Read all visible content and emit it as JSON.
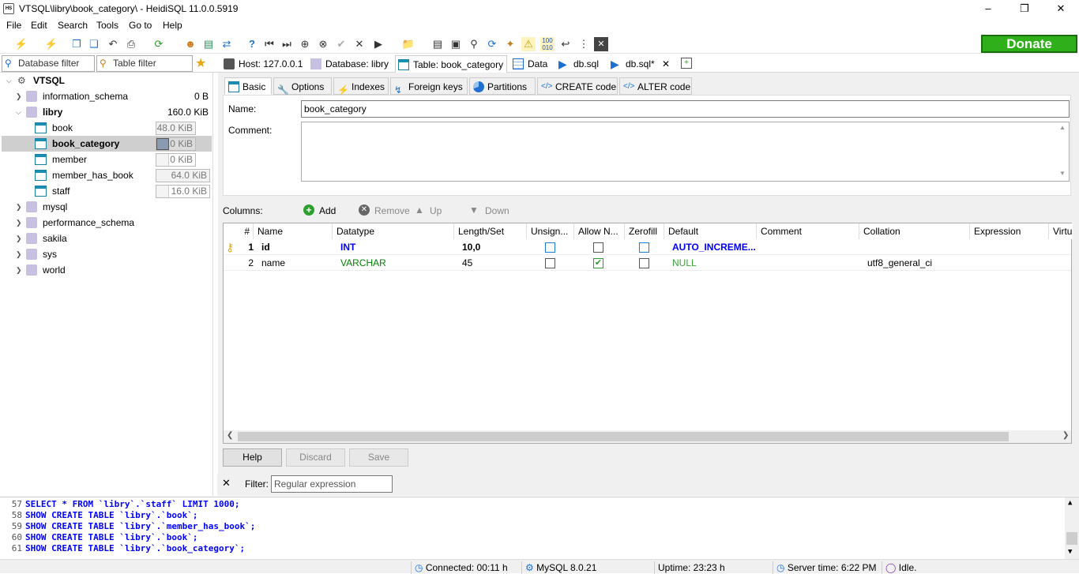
{
  "window": {
    "title": "VTSQL\\libry\\book_category\\ - HeidiSQL 11.0.0.5919",
    "app_icon": "HS"
  },
  "menu": [
    "File",
    "Edit",
    "Search",
    "Tools",
    "Go to",
    "Help"
  ],
  "toolbar": {
    "donate_label": "Donate"
  },
  "filters": {
    "database_filter": "Database filter",
    "table_filter": "Table filter"
  },
  "main_tabs": [
    {
      "label": "Host: 127.0.0.1"
    },
    {
      "label": "Database: libry"
    },
    {
      "label": "Table: book_category"
    },
    {
      "label": "Data"
    },
    {
      "label": "db.sql"
    },
    {
      "label": "db.sql*"
    }
  ],
  "tree": {
    "root": "VTSQL",
    "nodes": [
      {
        "label": "information_schema",
        "size": "0 B"
      },
      {
        "label": "libry",
        "size": "160.0 KiB"
      },
      {
        "label": "book",
        "size": "48.0 KiB"
      },
      {
        "label": "book_category",
        "size": "16.0 KiB"
      },
      {
        "label": "member",
        "size": "16.0 KiB"
      },
      {
        "label": "member_has_book",
        "size": "64.0 KiB"
      },
      {
        "label": "staff",
        "size": "16.0 KiB"
      },
      {
        "label": "mysql"
      },
      {
        "label": "performance_schema"
      },
      {
        "label": "sakila"
      },
      {
        "label": "sys"
      },
      {
        "label": "world"
      }
    ]
  },
  "sub_tabs": [
    "Basic",
    "Options",
    "Indexes",
    "Foreign keys",
    "Partitions",
    "CREATE code",
    "ALTER code"
  ],
  "basic": {
    "name_label": "Name:",
    "name_value": "book_category",
    "comment_label": "Comment:",
    "comment_value": ""
  },
  "columns_bar": {
    "label": "Columns:",
    "add": "Add",
    "remove": "Remove",
    "up": "Up",
    "down": "Down"
  },
  "grid": {
    "headers": [
      "#",
      "Name",
      "Datatype",
      "Length/Set",
      "Unsign...",
      "Allow N...",
      "Zerofill",
      "Default",
      "Comment",
      "Collation",
      "Expression",
      "Virtu"
    ],
    "rows": [
      {
        "num": "1",
        "name": "id",
        "datatype": "INT",
        "length": "10,0",
        "unsigned": false,
        "allow_null": false,
        "zerofill": false,
        "default": "AUTO_INCREME...",
        "comment": "",
        "collation": "",
        "expression": ""
      },
      {
        "num": "2",
        "name": "name",
        "datatype": "VARCHAR",
        "length": "45",
        "unsigned": false,
        "allow_null": true,
        "zerofill": false,
        "default": "NULL",
        "comment": "",
        "collation": "utf8_general_ci",
        "expression": ""
      }
    ]
  },
  "buttons": {
    "help": "Help",
    "discard": "Discard",
    "save": "Save"
  },
  "filter_row": {
    "label": "Filter:",
    "placeholder": "Regular expression"
  },
  "log": [
    {
      "n": "57",
      "text": "SELECT * FROM `libry`.`staff` LIMIT 1000;"
    },
    {
      "n": "58",
      "text": "SHOW CREATE TABLE `libry`.`book`;"
    },
    {
      "n": "59",
      "text": "SHOW CREATE TABLE `libry`.`member_has_book`;"
    },
    {
      "n": "60",
      "text": "SHOW CREATE TABLE `libry`.`book`;"
    },
    {
      "n": "61",
      "text": "SHOW CREATE TABLE `libry`.`book_category`;"
    }
  ],
  "status": {
    "connected": "Connected: 00:11 h",
    "server": "MySQL 8.0.21",
    "uptime": "Uptime: 23:23 h",
    "server_time": "Server time: 6:22 PM",
    "state": "Idle."
  },
  "colors": {
    "accent": "#0078d7",
    "donate": "#2fb01a",
    "sql_keyword": "#0000ff",
    "datatype_int": "#0000ff",
    "datatype_varchar": "#008000"
  }
}
